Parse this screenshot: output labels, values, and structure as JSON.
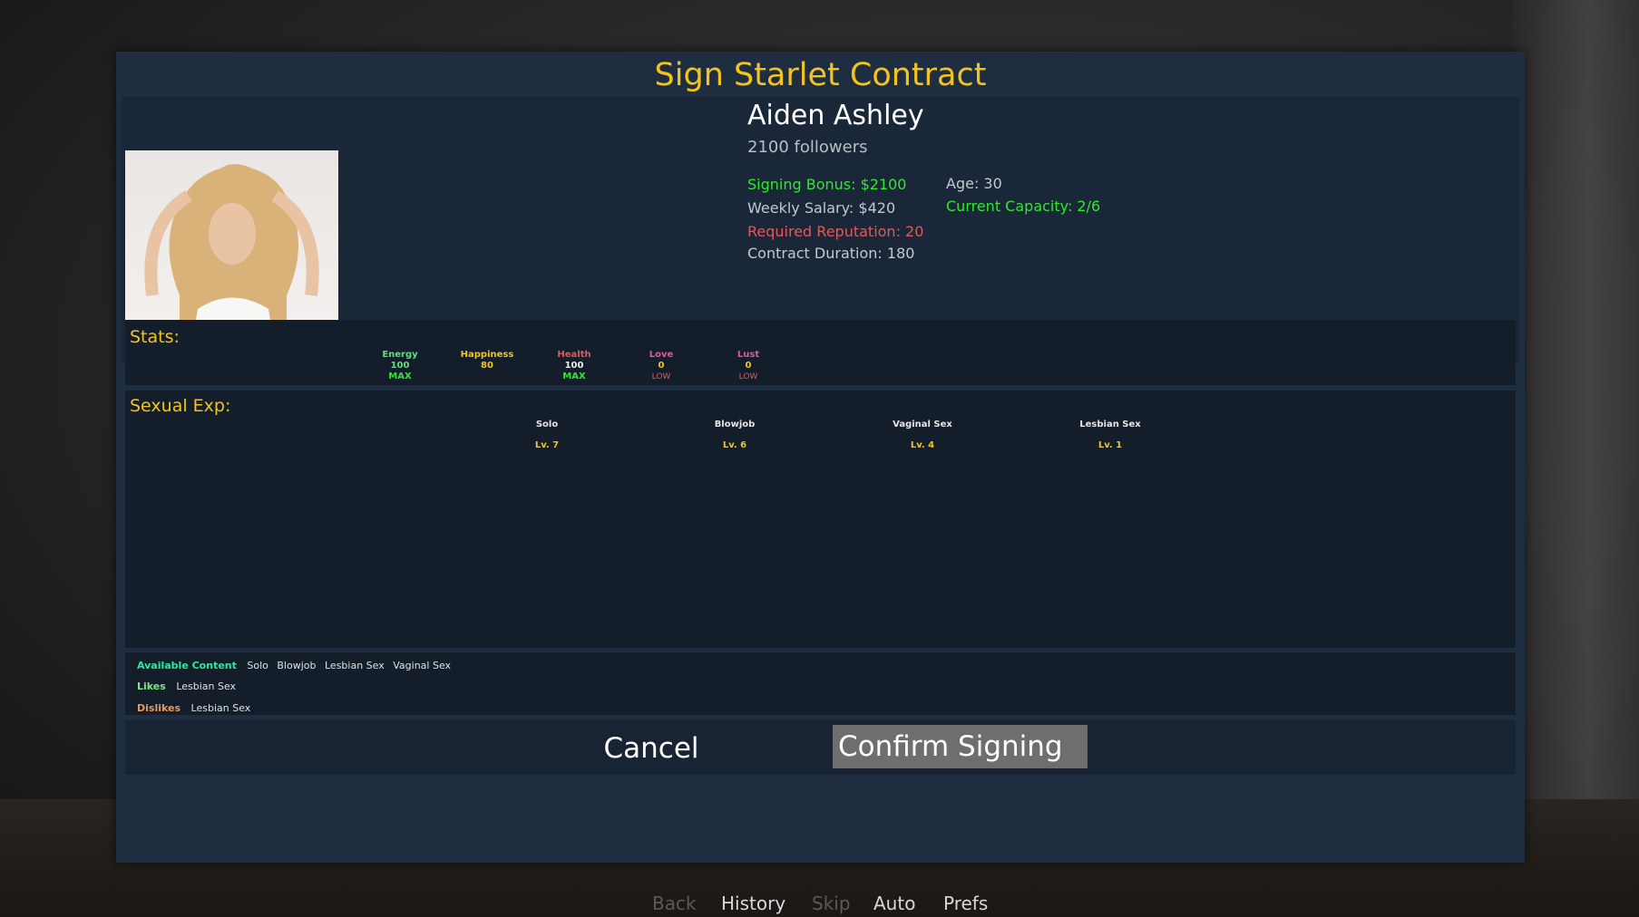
{
  "dialog": {
    "title": "Sign Starlet Contract"
  },
  "starlet": {
    "name": "Aiden Ashley",
    "followers": "2100 followers",
    "signing_bonus": "Signing Bonus: $2100",
    "weekly_salary": "Weekly Salary: $420",
    "required_reputation": "Required Reputation: 20",
    "contract_duration": "Contract Duration: 180",
    "age": "Age: 30",
    "current_capacity": "Current Capacity: 2/6"
  },
  "stats": {
    "label": "Stats:",
    "items": [
      {
        "name": "Energy",
        "value": "100",
        "status": "MAX",
        "color": "#5fe07a",
        "status_color": "#2ee82e"
      },
      {
        "name": "Happiness",
        "value": "80",
        "status": "",
        "color": "#f2c41c",
        "status_color": "#f2c41c"
      },
      {
        "name": "Health",
        "value": "100",
        "status": "MAX",
        "color": "#e05a5a",
        "status_color": "#2ee82e"
      },
      {
        "name": "Love",
        "value": "0",
        "status": "LOW",
        "color": "#e05a9a",
        "status_color": "#e05a5a"
      },
      {
        "name": "Lust",
        "value": "0",
        "status": "LOW",
        "color": "#e05a9a",
        "status_color": "#e05a5a"
      }
    ]
  },
  "sexual_exp": {
    "label": "Sexual Exp:",
    "items": [
      {
        "name": "Solo",
        "level": "Lv. 7"
      },
      {
        "name": "Blowjob",
        "level": "Lv. 6"
      },
      {
        "name": "Vaginal Sex",
        "level": "Lv. 4"
      },
      {
        "name": "Lesbian Sex",
        "level": "Lv. 1"
      }
    ]
  },
  "content": {
    "available_label": "Available Content",
    "available": [
      "Solo",
      "Blowjob",
      "Lesbian Sex",
      "Vaginal Sex"
    ],
    "likes_label": "Likes",
    "likes": [
      "Lesbian Sex"
    ],
    "dislikes_label": "Dislikes",
    "dislikes": [
      "Lesbian Sex"
    ]
  },
  "buttons": {
    "cancel": "Cancel",
    "confirm": "Confirm Signing"
  },
  "quick_menu": {
    "back": "Back",
    "history": "History",
    "skip": "Skip",
    "auto": "Auto",
    "prefs": "Prefs"
  },
  "colors": {
    "accent": "#f2c41c",
    "positive": "#2ee82e",
    "negative": "#e05a5a",
    "available": "#2ee8a0",
    "likes": "#7ee87e",
    "dislikes": "#e89a5a"
  }
}
